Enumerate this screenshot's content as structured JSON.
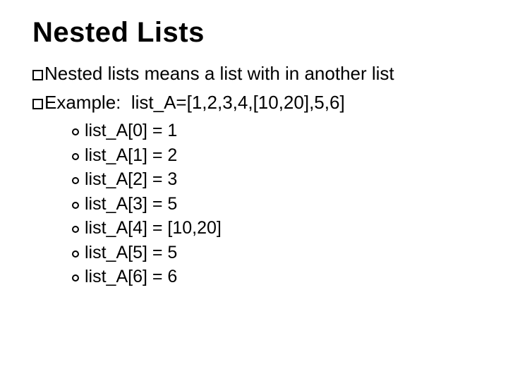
{
  "title": "Nested Lists",
  "points": {
    "p1_text": "Nested lists means a list with in another list",
    "p2_prefix": "Example:",
    "p2_code": "list_A=[1,2,3,4,[10,20],5,6]"
  },
  "sub": {
    "s0": "list_A[0] = 1",
    "s1": "list_A[1] = 2",
    "s2": "list_A[2] = 3",
    "s3": "list_A[3] = 5",
    "s4": "list_A[4] = [10,20]",
    "s5": "list_A[5] = 5",
    "s6": "list_A[6] = 6"
  }
}
